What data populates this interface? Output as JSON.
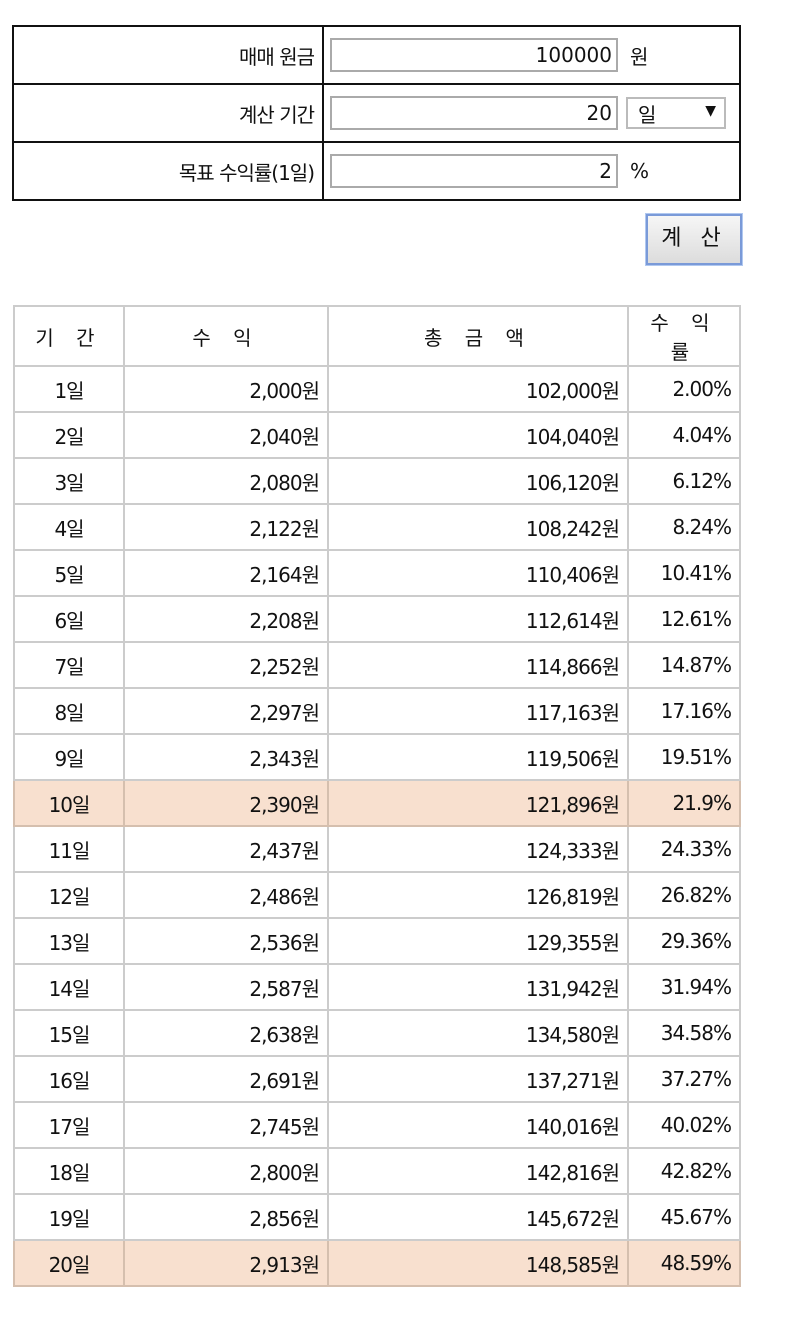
{
  "form": {
    "principal_label": "매매 원금",
    "principal_value": "100000",
    "principal_unit": "원",
    "period_label": "계산 기간",
    "period_value": "20",
    "period_unit_selected": "일",
    "rate_label": "목표 수익률(1일)",
    "rate_value": "2",
    "rate_unit": "%"
  },
  "calc_button": "계 산",
  "table": {
    "headers": [
      "기 간",
      "수 익",
      "총 금 액",
      "수 익 률"
    ],
    "rows": [
      [
        "1일",
        "2,000원",
        "102,000원",
        "2.00%"
      ],
      [
        "2일",
        "2,040원",
        "104,040원",
        "4.04%"
      ],
      [
        "3일",
        "2,080원",
        "106,120원",
        "6.12%"
      ],
      [
        "4일",
        "2,122원",
        "108,242원",
        "8.24%"
      ],
      [
        "5일",
        "2,164원",
        "110,406원",
        "10.41%"
      ],
      [
        "6일",
        "2,208원",
        "112,614원",
        "12.61%"
      ],
      [
        "7일",
        "2,252원",
        "114,866원",
        "14.87%"
      ],
      [
        "8일",
        "2,297원",
        "117,163원",
        "17.16%"
      ],
      [
        "9일",
        "2,343원",
        "119,506원",
        "19.51%"
      ],
      [
        "10일",
        "2,390원",
        "121,896원",
        "21.9%"
      ],
      [
        "11일",
        "2,437원",
        "124,333원",
        "24.33%"
      ],
      [
        "12일",
        "2,486원",
        "126,819원",
        "26.82%"
      ],
      [
        "13일",
        "2,536원",
        "129,355원",
        "29.36%"
      ],
      [
        "14일",
        "2,587원",
        "131,942원",
        "31.94%"
      ],
      [
        "15일",
        "2,638원",
        "134,580원",
        "34.58%"
      ],
      [
        "16일",
        "2,691원",
        "137,271원",
        "37.27%"
      ],
      [
        "17일",
        "2,745원",
        "140,016원",
        "40.02%"
      ],
      [
        "18일",
        "2,800원",
        "142,816원",
        "42.82%"
      ],
      [
        "19일",
        "2,856원",
        "145,672원",
        "45.67%"
      ],
      [
        "20일",
        "2,913원",
        "148,585원",
        "48.59%"
      ]
    ],
    "highlighted_rows": [
      10,
      20
    ],
    "highlight_color": "#f8e0cf"
  }
}
